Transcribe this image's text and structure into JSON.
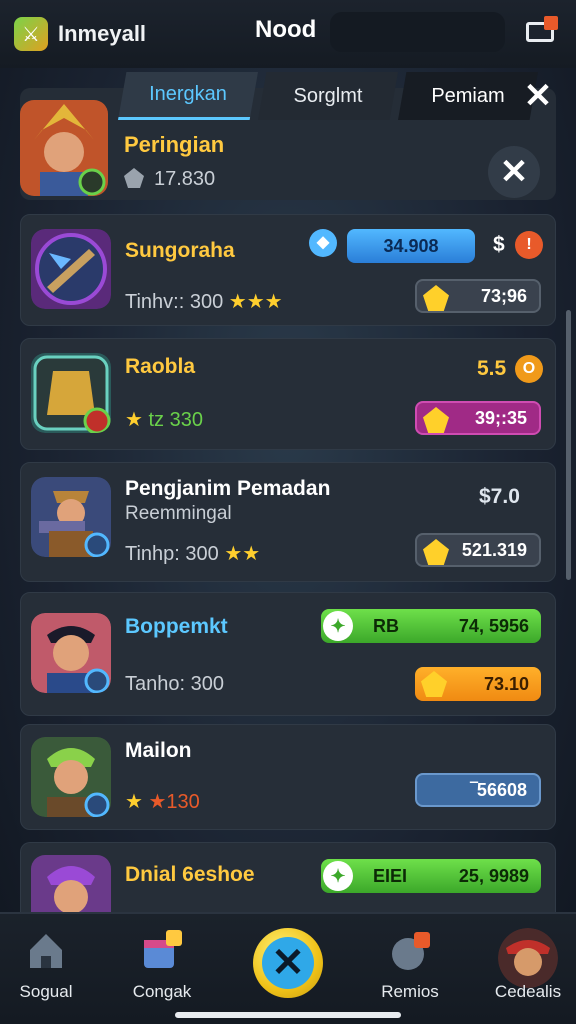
{
  "header": {
    "app_title": "Inmeyall",
    "center_title": "Nood"
  },
  "tabs": [
    {
      "label": "Inergkan"
    },
    {
      "label": "Sorglmt"
    },
    {
      "label": "Pemiam"
    }
  ],
  "profile": {
    "name": "Peringian",
    "score": "17.830"
  },
  "cards": [
    {
      "name": "Sungoraha",
      "level": "Tinhv:: 300",
      "stars": "★★★",
      "badge_value": "34.908",
      "price": "$",
      "pill_value": "73;96"
    },
    {
      "name": "Raobla",
      "level": "tz 330",
      "price": "5.5",
      "pill_value": "39;:35"
    },
    {
      "name": "Pengjanim Pemadan",
      "sub": "Reemmingal",
      "level": "Tinhp: 300",
      "stars": "★★",
      "price": "$7.0",
      "pill_value": "521.319"
    },
    {
      "name": "Boppemkt",
      "level": "Tanho: 300",
      "green_label": "RB",
      "green_value": "74, 5956",
      "pill_value": "73.10"
    },
    {
      "name": "Mailon",
      "level": "★130",
      "pill_value": "‾56608"
    },
    {
      "name": "Dnial 6eshoe",
      "green_label": "EIEI",
      "green_value": "25, 9989"
    }
  ],
  "nav": [
    {
      "label": "Sogual"
    },
    {
      "label": "Congak"
    },
    {
      "label": "Remios"
    },
    {
      "label": "Cedealis"
    }
  ],
  "colors": {
    "accent_blue": "#5cc8ff",
    "gold": "#ffc940",
    "green": "#6ee04a",
    "purple": "#a02a86"
  }
}
